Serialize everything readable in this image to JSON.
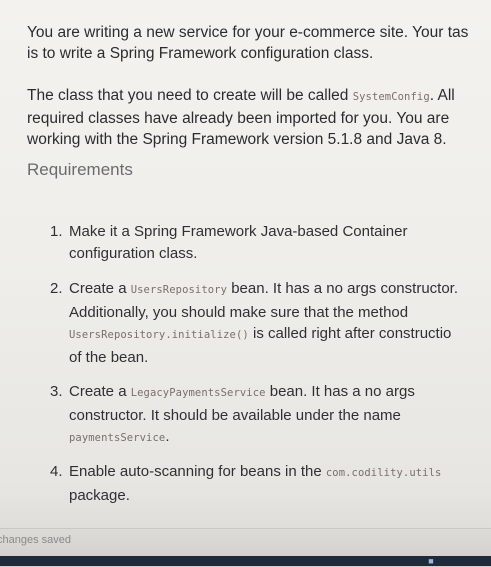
{
  "intro": {
    "line1": "You are writing a new service for your e-commerce site. Your tas",
    "line2": "is to write a Spring Framework configuration class."
  },
  "details": {
    "line1_pre": "The class that you need to create will be called ",
    "line1_code": "SystemConfig",
    "line1_post": ". All",
    "line2": "required classes have already been imported for you. You are",
    "line3": "working with the Spring Framework version 5.1.8 and Java 8."
  },
  "requirements": {
    "heading": "Requirements",
    "items": [
      {
        "number": "1.",
        "line1": "Make it a Spring Framework Java-based Container",
        "line2": "configuration class."
      },
      {
        "number": "2.",
        "line1_pre": "Create a ",
        "line1_code": "UsersRepository",
        "line1_post": " bean. It has a no args constructor.",
        "line2": "Additionally, you should make sure that the method",
        "line3_code": "UsersRepository.initialize()",
        "line3_post": " is called right after constructio",
        "line4": "of the bean."
      },
      {
        "number": "3.",
        "line1_pre": "Create a ",
        "line1_code": "LegacyPaymentsService",
        "line1_post": " bean. It has a no args",
        "line2": "constructor. It should be available under the name",
        "line3_code": "paymentsService",
        "line3_post": "."
      },
      {
        "number": "4.",
        "line1_pre": "Enable auto-scanning for beans in the ",
        "line1_code": "com.codility.utils",
        "line2": "package."
      }
    ]
  },
  "status_bar": {
    "text": "changes saved"
  }
}
